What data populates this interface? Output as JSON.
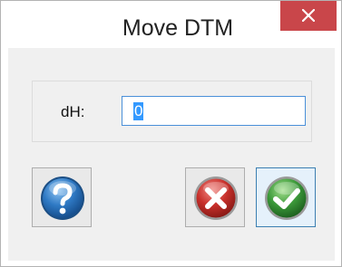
{
  "window": {
    "title": "Move DTM"
  },
  "form": {
    "dh_label": "dH:",
    "dh_value": "0"
  },
  "colors": {
    "close_button": "#c9464a",
    "input_border": "#4a90d9",
    "selection": "#3399ff",
    "help_icon": "#2e79c4",
    "cancel_icon": "#c8302b",
    "ok_icon": "#3c9a3a"
  },
  "icons": {
    "close": "close-icon",
    "help": "question-icon",
    "cancel": "cancel-x-icon",
    "ok": "checkmark-icon"
  }
}
